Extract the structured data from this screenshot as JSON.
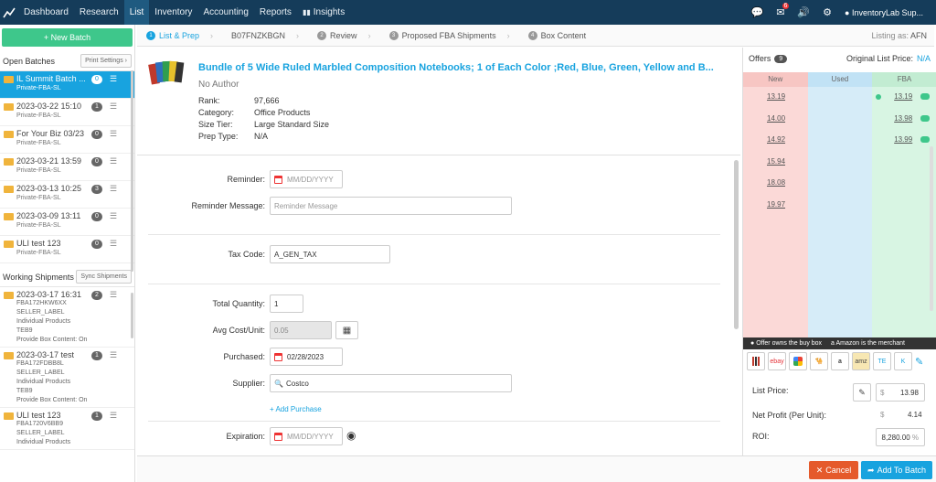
{
  "nav": {
    "items": [
      "Dashboard",
      "Research",
      "List",
      "Inventory",
      "Accounting",
      "Reports",
      "Insights"
    ],
    "active": "List",
    "notif_count": "6",
    "user": "InventoryLab Sup..."
  },
  "sidebar": {
    "new_batch": "+ New Batch",
    "open_batches_title": "Open Batches",
    "print_settings": "Print Settings",
    "batches": [
      {
        "title": "IL Summit Batch ...",
        "sub": "Private-FBA-SL",
        "count": "0"
      },
      {
        "title": "2023-03-22 15:10",
        "sub": "Private-FBA-SL",
        "count": "1"
      },
      {
        "title": "For Your Biz 03/23",
        "sub": "Private-FBA-SL",
        "count": "0"
      },
      {
        "title": "2023-03-21 13:59",
        "sub": "Private-FBA-SL",
        "count": "0"
      },
      {
        "title": "2023-03-13 10:25",
        "sub": "Private-FBA-SL",
        "count": "3"
      },
      {
        "title": "2023-03-09 13:11",
        "sub": "Private-FBA-SL",
        "count": "0"
      },
      {
        "title": "ULI test 123",
        "sub": "Private-FBA-SL",
        "count": "0"
      }
    ],
    "working_title": "Working Shipments",
    "sync_btn": "Sync Shipments",
    "shipments": [
      {
        "title": "2023-03-17 16:31",
        "lines": [
          "FBA172HKW6XX",
          "SELLER_LABEL",
          "Individual Products",
          "TEB9",
          "Provide Box Content: On"
        ],
        "count": "2"
      },
      {
        "title": "2023-03-17 test",
        "lines": [
          "FBA172FDBB8L",
          "SELLER_LABEL",
          "Individual Products",
          "TEB9",
          "Provide Box Content: On"
        ],
        "count": "1"
      },
      {
        "title": "ULI test 123",
        "lines": [
          "FBA1720V6BB9",
          "SELLER_LABEL",
          "Individual Products"
        ],
        "count": "1"
      }
    ]
  },
  "steps": {
    "items": [
      "List & Prep",
      "B07FNZKBGN",
      "Review",
      "Proposed FBA Shipments",
      "Box Content"
    ],
    "listing_as_label": "Listing as:",
    "listing_as_value": "AFN"
  },
  "product": {
    "title": "Bundle of 5 Wide Ruled Marbled Composition Notebooks; 1 of Each Color ;Red, Blue, Green, Yellow and B...",
    "author": "No Author",
    "rank_k": "Rank:",
    "rank_v": "97,666",
    "cat_k": "Category:",
    "cat_v": "Office Products",
    "size_k": "Size Tier:",
    "size_v": "Large Standard Size",
    "prep_k": "Prep Type:",
    "prep_v": "N/A"
  },
  "form": {
    "reminder_label": "Reminder:",
    "reminder_ph": "MM/DD/YYYY",
    "reminder_msg_label": "Reminder Message:",
    "reminder_msg_ph": "Reminder Message",
    "tax_label": "Tax Code:",
    "tax_value": "A_GEN_TAX",
    "qty_label": "Total Quantity:",
    "qty_value": "1",
    "cost_label": "Avg Cost/Unit:",
    "cost_value": "0.05",
    "purchased_label": "Purchased:",
    "purchased_value": "02/28/2023",
    "supplier_label": "Supplier:",
    "supplier_value": "Costco",
    "add_purchase": "+ Add Purchase",
    "expiration_label": "Expiration:",
    "expiration_ph": "MM/DD/YYYY"
  },
  "offers": {
    "title": "Offers",
    "count": "9",
    "olp_label": "Original List Price:",
    "olp_value": "N/A",
    "col_new": "New",
    "col_used": "Used",
    "col_fba": "FBA",
    "new_prices": [
      "13.19",
      "14.00",
      "14.92",
      "15.94",
      "18.08",
      "19.97"
    ],
    "fba_prices": [
      "13.19",
      "13.98",
      "13.99"
    ],
    "legend1": "Offer owns the buy box",
    "legend2": "Amazon is the merchant",
    "stores": [
      "ebay",
      "amz",
      "a",
      "TE",
      "K"
    ]
  },
  "calc": {
    "list_price_label": "List Price:",
    "list_price_value": "13.98",
    "currency": "$",
    "net_profit_label": "Net Profit (Per Unit):",
    "net_profit_currency": "$",
    "net_profit_value": "4.14",
    "roi_label": "ROI:",
    "roi_value": "8,280.00",
    "roi_unit": "%"
  },
  "footer": {
    "cancel": "Cancel",
    "add": "Add To Batch"
  },
  "colors": {
    "nav": "#153c5a",
    "accent": "#18a3df",
    "green": "#3ec78b",
    "cancel": "#e55a2b"
  }
}
